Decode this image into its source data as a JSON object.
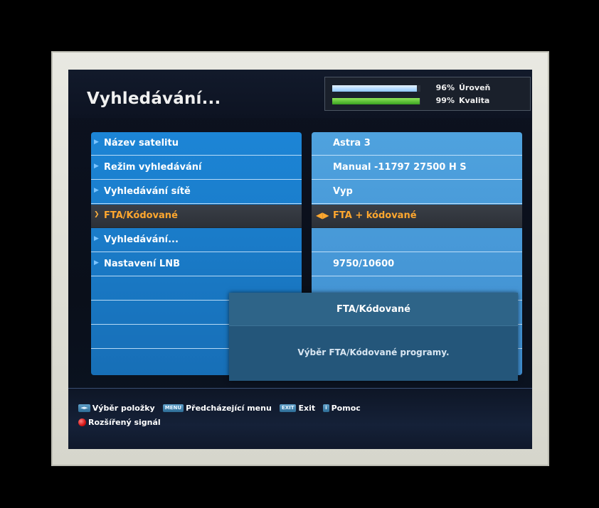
{
  "header": {
    "title": "Vyhledávání...",
    "signal": {
      "level_pct_text": "96%",
      "level_label": "Úroveň",
      "level_value": 0.96,
      "quality_pct_text": "99%",
      "quality_label": "Kvalita",
      "quality_value": 0.99
    }
  },
  "menu": {
    "items": [
      {
        "label": "Název satelitu",
        "value": "Astra 3"
      },
      {
        "label": "Režim vyhledávání",
        "value": "Manual -11797 27500 H S"
      },
      {
        "label": "Vyhledávání sítě",
        "value": "Vyp"
      },
      {
        "label": "FTA/Kódované",
        "value": "FTA + kódované",
        "selected": true
      },
      {
        "label": "Vyhledávání...",
        "value": ""
      },
      {
        "label": "Nastavení LNB",
        "value": "9750/10600"
      },
      {
        "label": "",
        "value": ""
      },
      {
        "label": "",
        "value": ""
      },
      {
        "label": "",
        "value": ""
      }
    ]
  },
  "popup": {
    "title": "FTA/Kódované",
    "body": "Výběr FTA/Kódované programy."
  },
  "footer": {
    "nav_key": "◄►",
    "nav_label": "Výběr položky",
    "menu_key": "MENU",
    "menu_label": "Předcházející menu",
    "exit_key": "EXIT",
    "exit_label": "Exit",
    "help_key": "i",
    "help_label": "Pomoc",
    "red_label": "Rozšířený signál"
  },
  "colors": {
    "menu_panel": "#1c85d6",
    "value_panel": "#4fa2de",
    "highlight_text": "#ffa72e",
    "level_bar": "#bfe0ff",
    "quality_bar": "#5ccb36"
  }
}
